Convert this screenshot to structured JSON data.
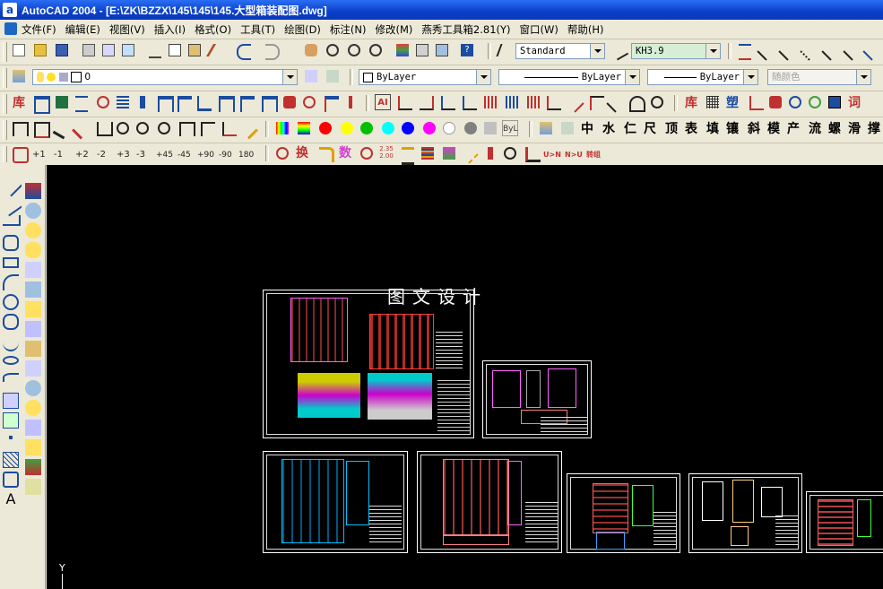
{
  "window": {
    "title": "AutoCAD 2004 - [E:\\ZK\\BZZX\\145\\145\\145.大型箱装配图.dwg]",
    "app_icon_letter": "a"
  },
  "menu": [
    "文件(F)",
    "编辑(E)",
    "视图(V)",
    "插入(I)",
    "格式(O)",
    "工具(T)",
    "绘图(D)",
    "标注(N)",
    "修改(M)",
    "燕秀工具箱2.81(Y)",
    "窗口(W)",
    "帮助(H)"
  ],
  "styles": {
    "text_style": "Standard",
    "dim_style": "KH3.9"
  },
  "layers": {
    "current_layer": "0",
    "color": "ByLayer",
    "linetype": "ByLayer",
    "lineweight": "ByLayer",
    "plotstyle": "随颜色"
  },
  "toolbar4_chars": [
    "中",
    "水",
    "仁",
    "尺",
    "顶",
    "表",
    "填",
    "镶",
    "斜",
    "模",
    "产",
    "流",
    "螺",
    "滑",
    "撑"
  ],
  "toolbar4_bylayer": "ByL",
  "toolbar5_nums": [
    "+1",
    "-1",
    "+2",
    "-2",
    "+3",
    "-3",
    "+45",
    "-45",
    "+90",
    "-90",
    "180"
  ],
  "toolbar5_labels": {
    "huan": "换",
    "shu": "数",
    "scale_top": "2.35",
    "scale_bottom": "2.00",
    "un": "U>N",
    "nu": "N>U",
    "zhuanzu": "转组"
  },
  "toolbar3_labels": {
    "ku": "库",
    "ai": "AI",
    "ku2": "库",
    "su": "塑",
    "ci": "词"
  },
  "canvas": {
    "title": "图文设计",
    "ucs_label": "Y"
  },
  "colors": {
    "titlebar": "#0a3fc8",
    "canvas_bg": "#000000",
    "swatches": [
      "#ff0000",
      "#ffff00",
      "#00c000",
      "#00ffff",
      "#0000ff",
      "#ff00ff",
      "#ffffff",
      "#808080",
      "#c0c0c0"
    ]
  }
}
